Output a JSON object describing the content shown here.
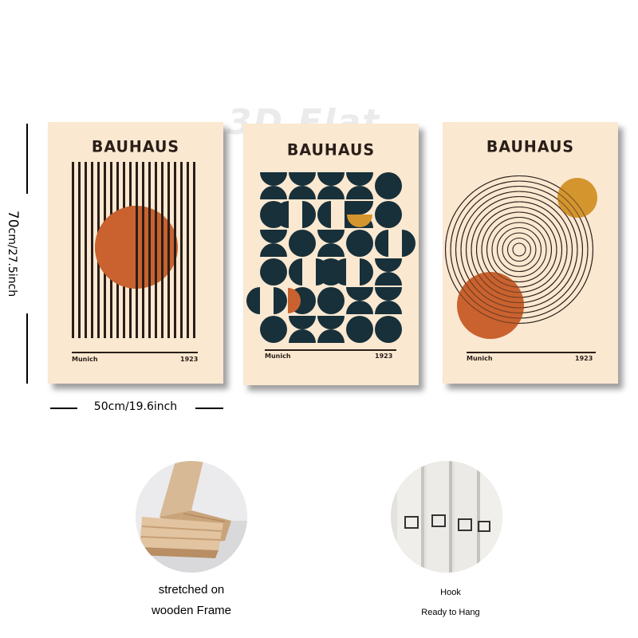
{
  "watermark": "3D Flat",
  "posters": [
    {
      "title": "BAUHAUS",
      "city": "Munich",
      "year": "1923",
      "design": "vertical-stripes-orange-circle"
    },
    {
      "title": "BAUHAUS",
      "city": "Munich",
      "year": "1923",
      "design": "navy-half-circle-grid"
    },
    {
      "title": "BAUHAUS",
      "city": "Munich",
      "year": "1923",
      "design": "concentric-rings-two-circles"
    }
  ],
  "dimensions": {
    "height_value": "70",
    "height_unit": "cm/27.5inch",
    "width_value": "50",
    "width_unit": "cm/19.6inch"
  },
  "features": {
    "frame_caption_line1": "stretched on",
    "frame_caption_line2": "wooden Frame",
    "hook_caption_line1": "Hook",
    "hook_caption_line2": "Ready to Hang"
  },
  "colors": {
    "poster_bg": "#fbe8d1",
    "ink": "#2a1e18",
    "orange": "#c9622f",
    "navy": "#17303a",
    "mustard": "#d4952e"
  }
}
